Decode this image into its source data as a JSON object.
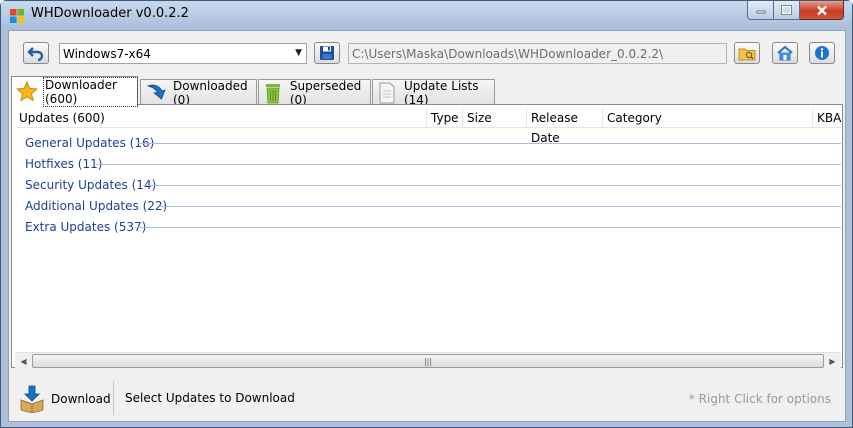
{
  "window": {
    "title": "WHDownloader v0.0.2.2"
  },
  "toolbar": {
    "os_selected": "Windows7-x64",
    "path_value": "C:\\Users\\Maska\\Downloads\\WHDownloader_0.0.2.2\\"
  },
  "tabs": [
    {
      "label": "Downloader (600)",
      "icon": "star-icon"
    },
    {
      "label": "Downloaded (0)",
      "icon": "down-arrow-icon"
    },
    {
      "label": "Superseded (0)",
      "icon": "trash-icon"
    },
    {
      "label": "Update Lists (14)",
      "icon": "document-icon"
    }
  ],
  "columns": [
    "Updates (600)",
    "Type",
    "Size",
    "Release Date",
    "Category",
    "KBA"
  ],
  "groups": [
    "General Updates (16)",
    "Hotfixes (11)",
    "Security Updates (14)",
    "Additional Updates (22)",
    "Extra Updates (537)"
  ],
  "bottom": {
    "download_label": "Download",
    "status": "Select Updates to Download",
    "hint": "* Right Click for options"
  },
  "colors": {
    "group_text": "#1e3e96",
    "accent_blue": "#1b74d1",
    "close_red": "#c63d23"
  }
}
